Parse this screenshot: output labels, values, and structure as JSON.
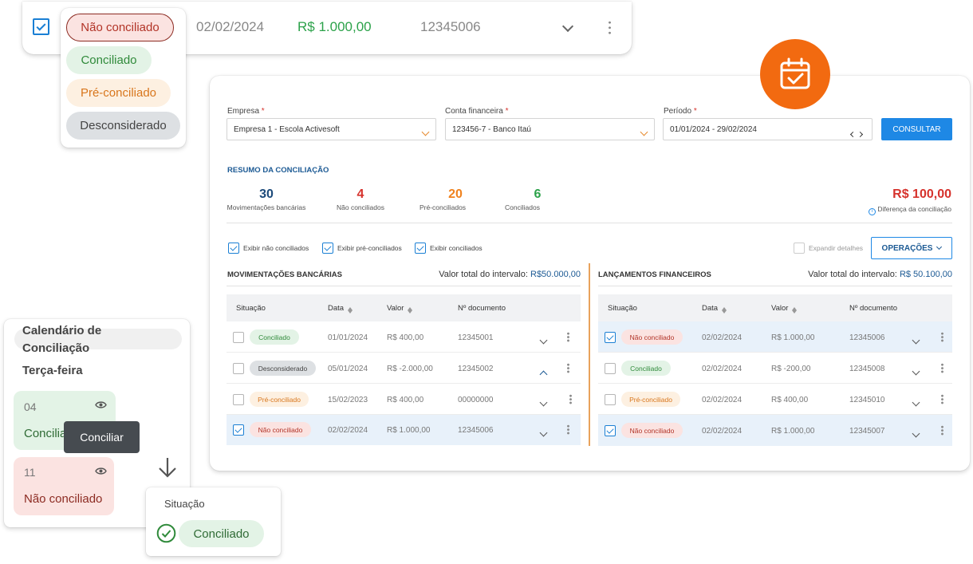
{
  "top_row": {
    "date": "02/02/2024",
    "value": "R$ 1.000,00",
    "doc": "12345006",
    "status_options": [
      "Não conciliado",
      "Conciliado",
      "Pré-conciliado",
      "Desconsiderado"
    ]
  },
  "filters": {
    "empresa_label": "Empresa",
    "empresa_value": "Empresa 1 - Escola Activesoft",
    "conta_label": "Conta financeira",
    "conta_value": "123456-7 - Banco Itaú",
    "periodo_label": "Período",
    "periodo_value": "01/01/2024 - 29/02/2024",
    "required_mark": "*",
    "consultar": "CONSULTAR"
  },
  "summary": {
    "title": "RESUMO DA CONCILIAÇÃO",
    "stats": [
      {
        "value": "30",
        "label": "Movimentações bancárias"
      },
      {
        "value": "4",
        "label": "Não conciliados"
      },
      {
        "value": "20",
        "label": "Pré-conciliados"
      },
      {
        "value": "6",
        "label": "Conciliados"
      }
    ],
    "diff_value": "R$ 100,00",
    "diff_label": "Diferença da conciliação"
  },
  "options": {
    "show_nao": "Exibir não conciliados",
    "show_pre": "Exibir pré-conciliados",
    "show_conc": "Exibir conciliados",
    "expand": "Expandir detalhes",
    "operacoes": "OPERAÇÕES"
  },
  "left_table": {
    "title": "MOVIMENTAÇÕES BANCÁRIAS",
    "total_label": "Valor total do intervalo:",
    "total_value": "R$50.000,00",
    "headers": [
      "Situação",
      "Data",
      "Valor",
      "Nº documento"
    ],
    "rows": [
      {
        "status": "Conciliado",
        "date": "01/01/2024",
        "value": "R$ 400,00",
        "doc": "12345001"
      },
      {
        "status": "Desconsiderado",
        "date": "05/01/2024",
        "value": "R$ -2.000,00",
        "doc": "12345002"
      },
      {
        "status": "Pré-conciliado",
        "date": "15/02/2023",
        "value": "R$ 400,00",
        "doc": "00000000"
      },
      {
        "status": "Não conciliado",
        "date": "02/02/2024",
        "value": "R$ 1.000,00",
        "doc": "12345006"
      }
    ]
  },
  "right_table": {
    "title": "LANÇAMENTOS FINANCEIROS",
    "total_label": "Valor total do intervalo:",
    "total_value": "R$ 50.100,00",
    "headers": [
      "Situação",
      "Data",
      "Valor",
      "Nº documento"
    ],
    "rows": [
      {
        "status": "Não conciliado",
        "date": "02/02/2024",
        "value": "R$ 1.000,00",
        "doc": "12345006"
      },
      {
        "status": "Conciliado",
        "date": "02/02/2024",
        "value": "R$ -200,00",
        "doc": "12345008"
      },
      {
        "status": "Pré-conciliado",
        "date": "02/02/2024",
        "value": "R$ 400,00",
        "doc": "12345010"
      },
      {
        "status": "Não conciliado",
        "date": "02/02/2024",
        "value": "R$ 1.000,00",
        "doc": "12345007"
      }
    ]
  },
  "calendar": {
    "title": "Calendário de Conciliação",
    "weekday": "Terça-feira",
    "day1": "04",
    "day1_status": "Concilia",
    "tooltip": "Conciliar",
    "day2": "11",
    "day2_status": "Não conciliado"
  },
  "situacao_card": {
    "label": "Situação",
    "value": "Conciliado"
  },
  "colors": {
    "accent_blue": "#1e88e5",
    "orange_badge": "#f26a10",
    "divider_orange": "#e8a25c"
  }
}
